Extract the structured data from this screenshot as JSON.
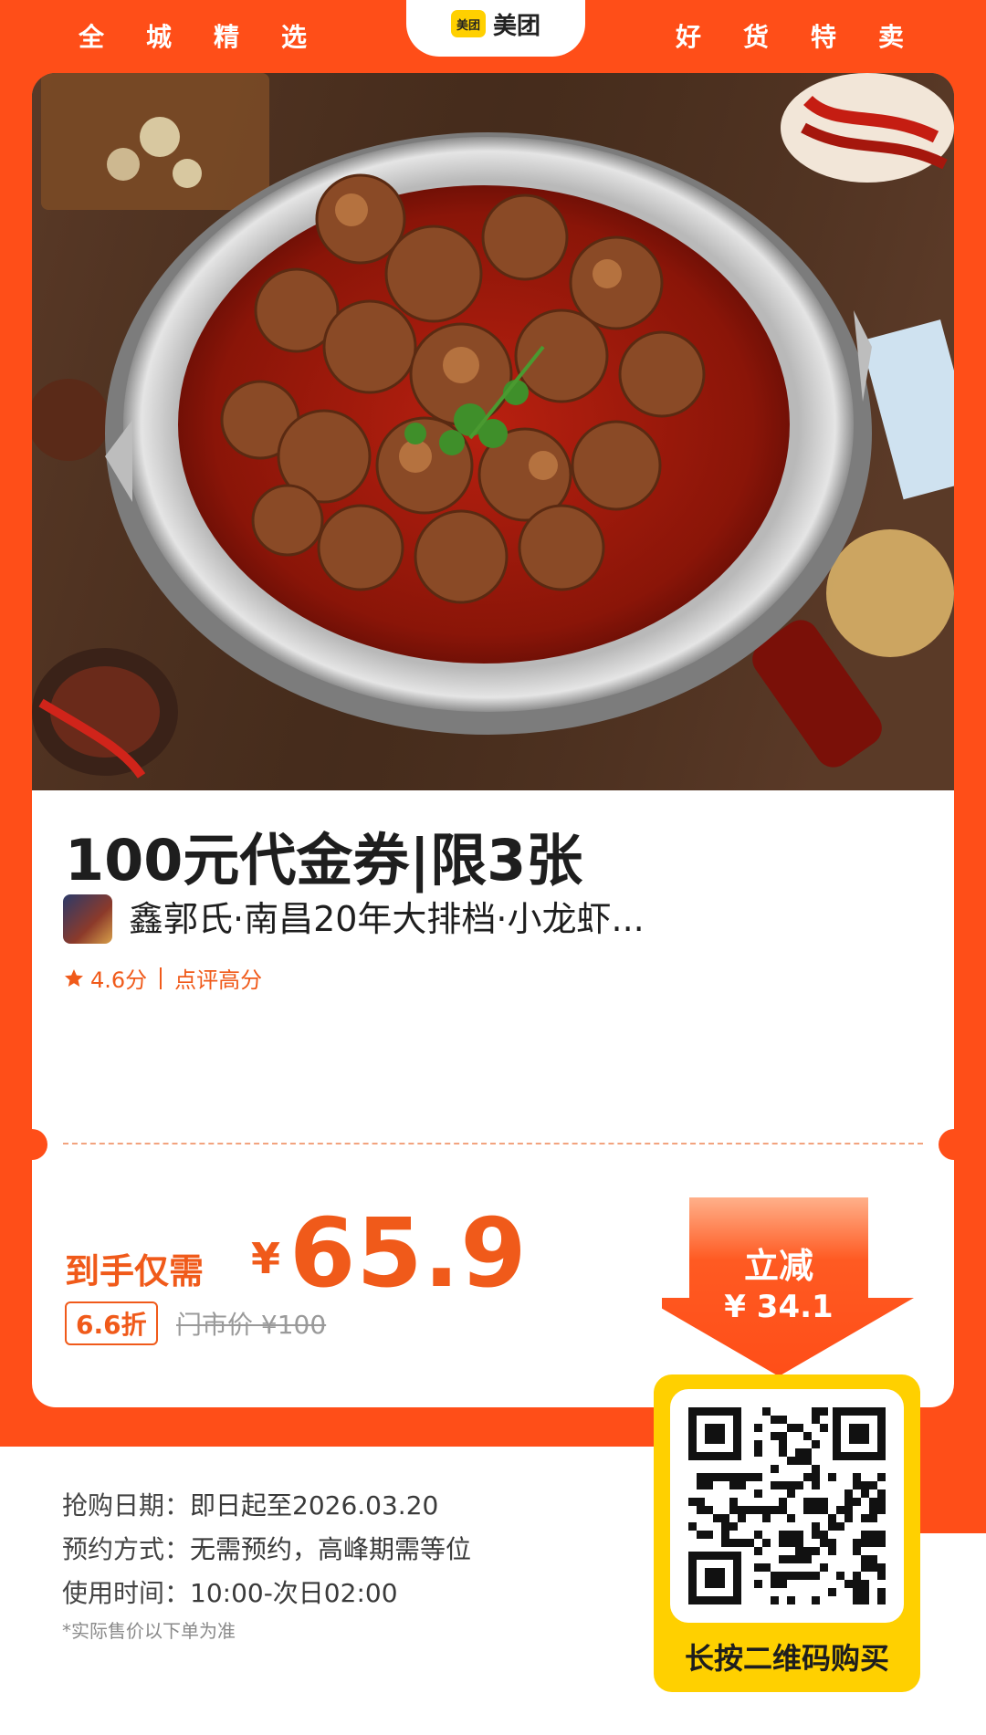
{
  "header": {
    "left_words": "全城精选",
    "right_words": "好货特卖",
    "brand_badge": "美团",
    "brand_name": "美团"
  },
  "product": {
    "title": "100元代金券|限3张",
    "shop_name": "鑫郭氏·南昌20年大排档·小龙虾...",
    "rating": "4.6分",
    "rating_tag": "点评高分"
  },
  "price": {
    "label": "到手仅需",
    "currency": "¥",
    "amount": "65.9",
    "discount": "6.6折",
    "original": "门市价 ¥100"
  },
  "savings": {
    "title": "立减",
    "amount": "¥ 34.1"
  },
  "qr": {
    "label": "长按二维码购买"
  },
  "info": [
    {
      "key": "抢购日期：",
      "value": "即日起至2026.03.20"
    },
    {
      "key": "预约方式：",
      "value": "无需预约，高峰期需等位"
    },
    {
      "key": "使用时间：",
      "value": "10:00-次日02:00"
    }
  ],
  "note": "*实际售价以下单为准",
  "colors": {
    "brand_orange": "#ff4e18",
    "price_orange": "#f05a1a",
    "meituan_yellow": "#ffd000"
  }
}
